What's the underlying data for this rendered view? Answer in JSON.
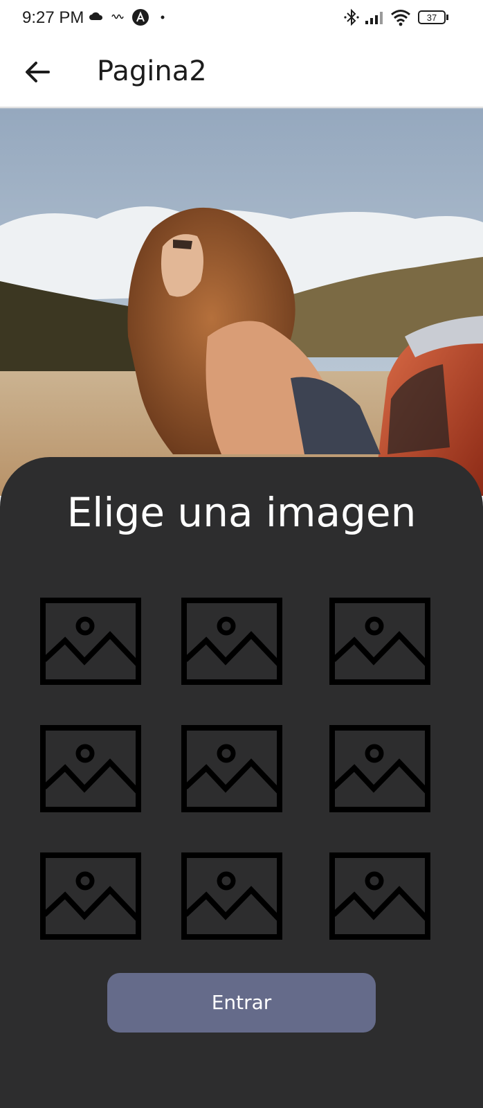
{
  "status_bar": {
    "time": "9:27 PM",
    "battery_level": "37",
    "icons": [
      "cloud-icon",
      "signal-waves-icon",
      "app-a-icon",
      "dot-icon",
      "bluetooth-icon",
      "cellular-signal-icon",
      "wifi-icon",
      "battery-icon"
    ]
  },
  "app_bar": {
    "title": "Pagina2",
    "back_icon": "arrow-left-icon"
  },
  "hero_image": {
    "icon": "photo"
  },
  "panel": {
    "title": "Elige una imagen",
    "image_options": [
      {
        "icon": "image-placeholder-icon"
      },
      {
        "icon": "image-placeholder-icon"
      },
      {
        "icon": "image-placeholder-icon"
      },
      {
        "icon": "image-placeholder-icon"
      },
      {
        "icon": "image-placeholder-icon"
      },
      {
        "icon": "image-placeholder-icon"
      },
      {
        "icon": "image-placeholder-icon"
      },
      {
        "icon": "image-placeholder-icon"
      },
      {
        "icon": "image-placeholder-icon"
      }
    ],
    "enter_button_label": "Entrar"
  },
  "colors": {
    "panel_background": "#2d2d2e",
    "button_background": "#656b8a",
    "title_text": "#ffffff"
  }
}
